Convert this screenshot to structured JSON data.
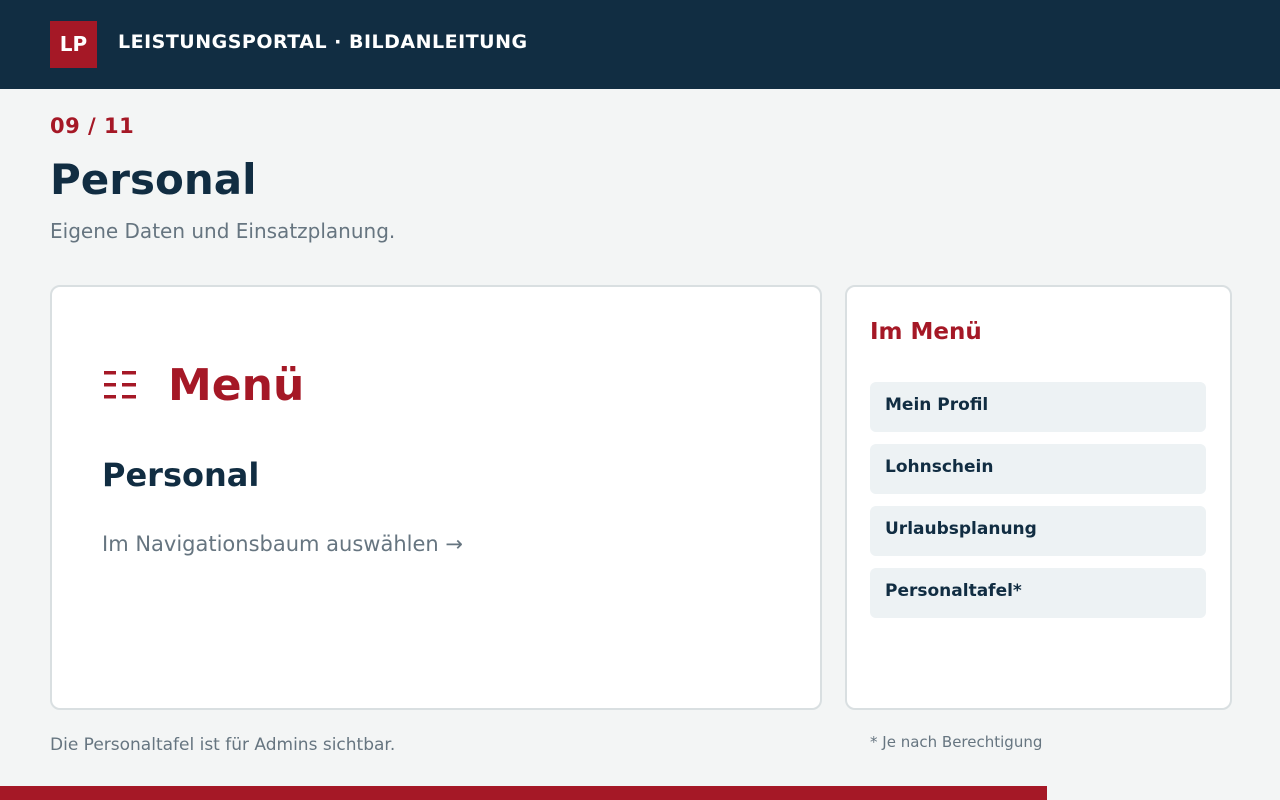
{
  "header": {
    "logo_text": "LP",
    "title": "LEISTUNGSPORTAL · BILDANLEITUNG"
  },
  "step": {
    "counter": "09 / 11",
    "title": "Personal",
    "subtitle": "Eigene Daten und Einsatzplanung."
  },
  "main_card": {
    "menu_icon": "menu-list-icon",
    "menu_label": "Menü",
    "heading": "Personal",
    "instruction": "Im Navigationsbaum auswählen →"
  },
  "side_card": {
    "title": "Im Menü",
    "items": [
      {
        "label": "Mein Profil"
      },
      {
        "label": "Lohnschein"
      },
      {
        "label": "Urlaubsplanung"
      },
      {
        "label": "Personaltafel*"
      }
    ]
  },
  "footer": {
    "note_left": "Die Personaltafel ist für Admins sichtbar.",
    "note_right": "* Je nach Berechtigung"
  },
  "progress": {
    "current_step": 9,
    "total_steps": 11,
    "fraction": 0.818
  },
  "colors": {
    "header_bg": "#112d42",
    "accent": "#a51826",
    "text_dark": "#112d42",
    "text_muted": "#667580",
    "page_bg": "#f3f5f5",
    "item_bg": "#edf2f4"
  }
}
